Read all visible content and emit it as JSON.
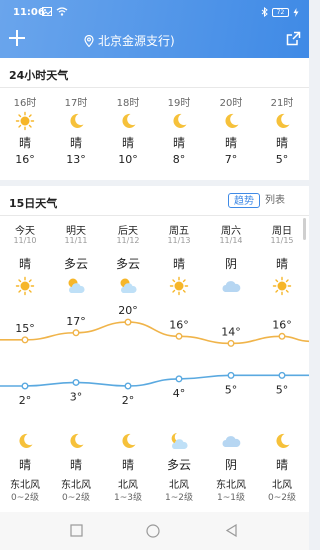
{
  "status_bar": {
    "time": "11:06",
    "battery": "72"
  },
  "header": {
    "location": "北京金源支行)"
  },
  "hourly": {
    "title": "24小时天气",
    "items": [
      {
        "time": "16时",
        "icon": "sun-icon",
        "cond": "晴",
        "temp": "16°"
      },
      {
        "time": "17时",
        "icon": "moon-icon",
        "cond": "晴",
        "temp": "13°"
      },
      {
        "time": "18时",
        "icon": "moon-icon",
        "cond": "晴",
        "temp": "10°"
      },
      {
        "time": "19时",
        "icon": "moon-icon",
        "cond": "晴",
        "temp": "8°"
      },
      {
        "time": "20时",
        "icon": "moon-icon",
        "cond": "晴",
        "temp": "7°"
      },
      {
        "time": "21时",
        "icon": "moon-icon",
        "cond": "晴",
        "temp": "5°"
      }
    ]
  },
  "daily": {
    "title": "15日天气",
    "toggle": {
      "trend": "趋势",
      "list": "列表"
    },
    "items": [
      {
        "day": "今天",
        "date": "11/10",
        "cond": "晴",
        "icon": "sun-icon",
        "high": 15,
        "high_label": "15°",
        "low": 2,
        "low_label": "2°",
        "night_icon": "moon-icon",
        "night_cond": "晴",
        "wind": "东北风",
        "wind_level": "0~2级"
      },
      {
        "day": "明天",
        "date": "11/11",
        "cond": "多云",
        "icon": "partly-cloudy-icon",
        "high": 17,
        "high_label": "17°",
        "low": 3,
        "low_label": "3°",
        "night_icon": "moon-icon",
        "night_cond": "晴",
        "wind": "东北风",
        "wind_level": "0~2级"
      },
      {
        "day": "后天",
        "date": "11/12",
        "cond": "多云",
        "icon": "partly-cloudy-icon",
        "high": 20,
        "high_label": "20°",
        "low": 2,
        "low_label": "2°",
        "night_icon": "moon-icon",
        "night_cond": "晴",
        "wind": "北风",
        "wind_level": "1~3级"
      },
      {
        "day": "周五",
        "date": "11/13",
        "cond": "晴",
        "icon": "sun-icon",
        "high": 16,
        "high_label": "16°",
        "low": 4,
        "low_label": "4°",
        "night_icon": "cloudy-night-icon",
        "night_cond": "多云",
        "wind": "北风",
        "wind_level": "1~2级"
      },
      {
        "day": "周六",
        "date": "11/14",
        "cond": "阴",
        "icon": "cloud-icon",
        "high": 14,
        "high_label": "14°",
        "low": 5,
        "low_label": "5°",
        "night_icon": "cloud-icon",
        "night_cond": "阴",
        "wind": "东北风",
        "wind_level": "1~1级"
      },
      {
        "day": "周日",
        "date": "11/15",
        "cond": "晴",
        "icon": "sun-icon",
        "high": 16,
        "high_label": "16°",
        "low": 5,
        "low_label": "5°",
        "night_icon": "moon-icon",
        "night_cond": "晴",
        "wind": "北风",
        "wind_level": "0~2级"
      }
    ],
    "colors": {
      "high_line": "#f0b44a",
      "low_line": "#5aa9e0"
    }
  }
}
